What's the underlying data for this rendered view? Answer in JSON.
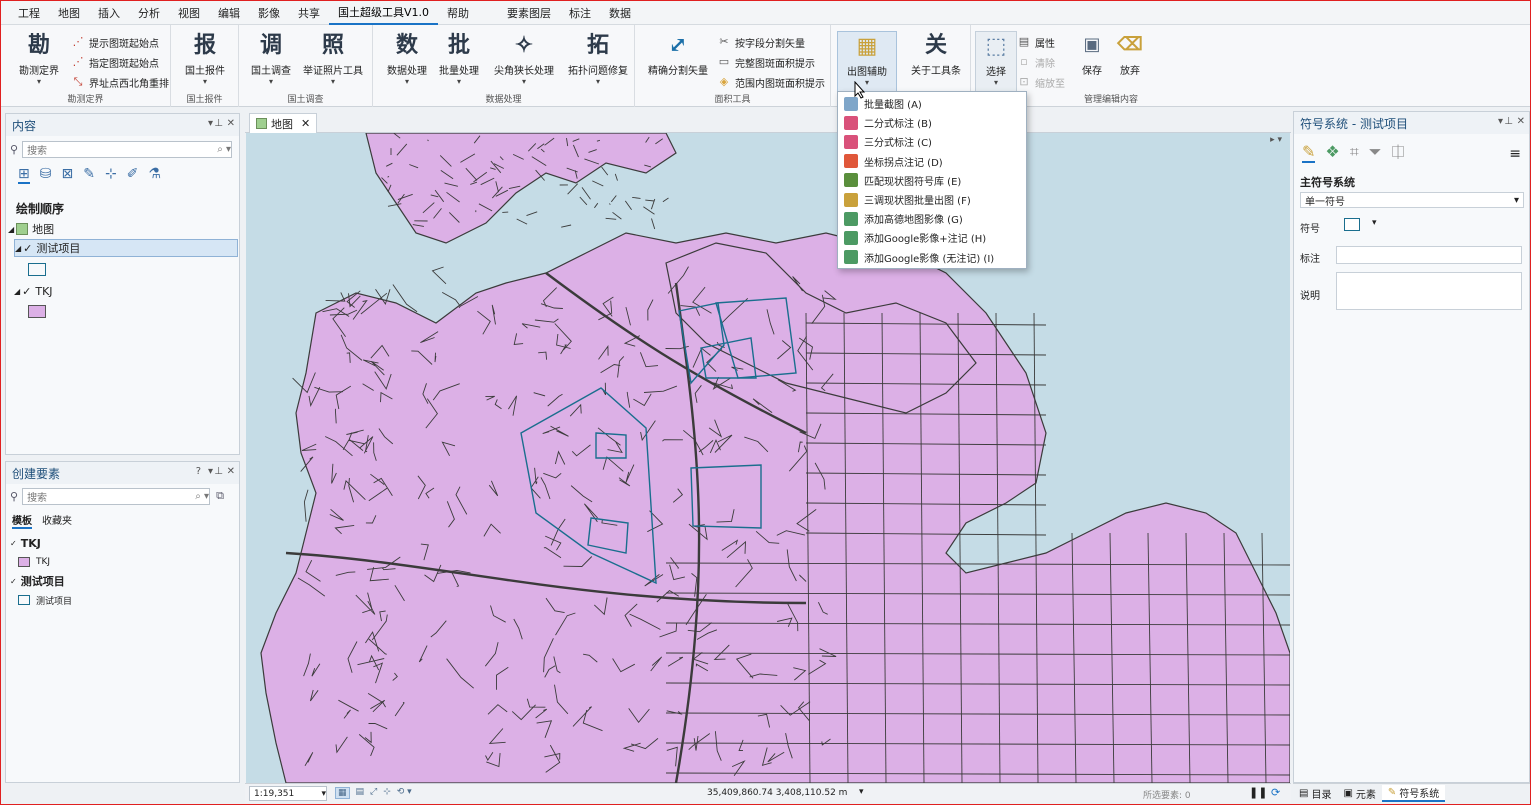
{
  "menubar": {
    "items": [
      "工程",
      "地图",
      "插入",
      "分析",
      "视图",
      "编辑",
      "影像",
      "共享",
      "国土超级工具V1.0",
      "帮助"
    ],
    "active_index": 8,
    "context_items": [
      "要素图层",
      "标注",
      "数据"
    ]
  },
  "ribbon": {
    "groups": [
      {
        "caption": "勘测定界",
        "buttons": [
          {
            "label": "勘测定界",
            "icon": "勘"
          }
        ],
        "small": [
          {
            "label": "提示图斑起始点"
          },
          {
            "label": "指定图斑起始点"
          },
          {
            "label": "界址点西北角重排"
          }
        ]
      },
      {
        "caption": "国土报件",
        "buttons": [
          {
            "label": "国土报件",
            "icon": "报"
          }
        ]
      },
      {
        "caption": "国土调查",
        "buttons": [
          {
            "label": "国土调查",
            "icon": "调"
          },
          {
            "label": "举证照片工具",
            "icon": "照"
          }
        ]
      },
      {
        "caption": "数据处理",
        "buttons": [
          {
            "label": "数据处理",
            "icon": "数"
          },
          {
            "label": "批量处理",
            "icon": "批"
          },
          {
            "label": "尖角狭长处理",
            "icon": "✧"
          },
          {
            "label": "拓扑问题修复",
            "icon": "拓"
          }
        ]
      },
      {
        "caption": "面积工具",
        "buttons": [
          {
            "label": "精确分割矢量",
            "icon": "⤢"
          }
        ],
        "small": [
          {
            "label": "按字段分割矢量"
          },
          {
            "label": "完整图斑面积提示"
          },
          {
            "label": "范围内图斑面积提示"
          }
        ]
      },
      {
        "caption": "",
        "buttons": [
          {
            "label": "出图辅助",
            "icon": "▦"
          },
          {
            "label": "关于工具条",
            "icon": "关"
          }
        ]
      },
      {
        "caption": "管理编辑内容",
        "buttons": [
          {
            "label": "选择",
            "icon": "⬚"
          },
          {
            "label": "保存",
            "icon": "💾"
          },
          {
            "label": "放弃",
            "icon": "🗑"
          }
        ],
        "small": [
          {
            "label": "属性"
          },
          {
            "label": "清除"
          },
          {
            "label": "缩放至"
          }
        ]
      }
    ]
  },
  "dropdown": {
    "items": [
      {
        "label": "批量截图 (A)",
        "color": "#7fa6c9"
      },
      {
        "label": "二分式标注 (B)",
        "color": "#d9517a"
      },
      {
        "label": "三分式标注 (C)",
        "color": "#d9517a"
      },
      {
        "label": "坐标拐点注记 (D)",
        "color": "#e0573a"
      },
      {
        "label": "匹配现状图符号库 (E)",
        "color": "#5a8f3c"
      },
      {
        "label": "三调现状图批量出图 (F)",
        "color": "#c9a13b"
      },
      {
        "label": "添加高德地图影像 (G)",
        "color": "#4c9a63"
      },
      {
        "label": "添加Google影像+注记 (H)",
        "color": "#4c9a63"
      },
      {
        "label": "添加Google影像 (无注记) (I)",
        "color": "#4c9a63"
      }
    ]
  },
  "contents_panel": {
    "title": "内容",
    "search_placeholder": "搜索",
    "drawing_order_title": "绘制顺序",
    "tree": [
      {
        "label": "地图",
        "level": 0
      },
      {
        "label": "测试项目",
        "level": 1,
        "checked": true,
        "selected": true
      },
      {
        "label": "TKJ",
        "level": 1,
        "checked": true
      }
    ]
  },
  "create_features_panel": {
    "title": "创建要素",
    "search_placeholder": "搜索",
    "tabs": [
      "模板",
      "收藏夹"
    ],
    "groups": [
      {
        "label": "TKJ",
        "items": [
          "TKJ"
        ]
      },
      {
        "label": "测试项目",
        "items": [
          "测试项目"
        ]
      }
    ]
  },
  "map": {
    "tab_label": "地图",
    "fill_color": "#dcb0e6",
    "water_color": "#c5dce6",
    "line_color": "#3b3b3b",
    "project_line_color": "#1a6e8e"
  },
  "statusbar": {
    "scale": "1:19,351",
    "coordinates": "35,409,860.74 3,408,110.52 m",
    "selected_features": "所选要素: 0"
  },
  "symbology_panel": {
    "title": "符号系统 - 测试项目",
    "primary_title": "主符号系统",
    "renderer": "单一符号",
    "symbol_label": "符号",
    "label_label": "标注",
    "description_label": "说明"
  },
  "bottom_tabs": {
    "items": [
      "目录",
      "元素",
      "符号系统"
    ],
    "active_index": 2
  }
}
